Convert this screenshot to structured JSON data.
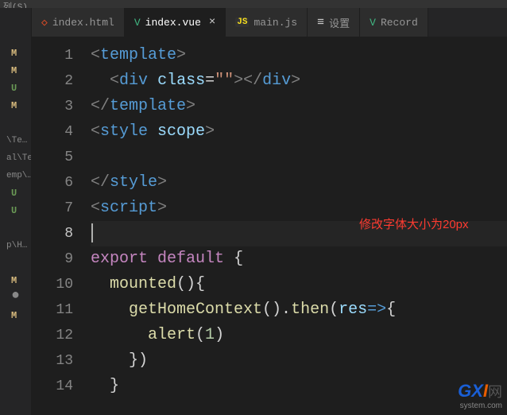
{
  "top_clipped": "列(S)   … ",
  "tabs": [
    {
      "label": "index.html",
      "icon": "html",
      "active": false,
      "close": false
    },
    {
      "label": "index.vue",
      "icon": "vue",
      "active": true,
      "close": true
    },
    {
      "label": "main.js",
      "icon": "js",
      "active": false,
      "close": false
    },
    {
      "label": "设置",
      "icon": "settings",
      "active": false,
      "close": false
    },
    {
      "label": "Record",
      "icon": "vue",
      "active": false,
      "close": false
    }
  ],
  "sidebar": {
    "items": [
      {
        "type": "mod",
        "text": "M"
      },
      {
        "type": "mod",
        "text": "M"
      },
      {
        "type": "u",
        "text": "U"
      },
      {
        "type": "mod",
        "text": "M"
      },
      {
        "type": "spacer",
        "text": ""
      },
      {
        "type": "path",
        "text": "\\Te…"
      },
      {
        "type": "path",
        "text": "al\\Te…"
      },
      {
        "type": "path",
        "text": "emp\\…"
      },
      {
        "type": "u",
        "text": "U"
      },
      {
        "type": "u",
        "text": "U"
      },
      {
        "type": "spacer",
        "text": ""
      },
      {
        "type": "path",
        "text": "p\\H…"
      },
      {
        "type": "spacer",
        "text": ""
      },
      {
        "type": "mod",
        "text": "M"
      },
      {
        "type": "dot",
        "text": "●"
      },
      {
        "type": "mod",
        "text": "M"
      }
    ]
  },
  "gutter": [
    "1",
    "2",
    "3",
    "4",
    "5",
    "6",
    "7",
    "8",
    "9",
    "10",
    "11",
    "12",
    "13",
    "14"
  ],
  "code": {
    "active_line": 8,
    "lines": [
      {
        "tokens": [
          [
            "p-bracket",
            "<"
          ],
          [
            "p-tag",
            "template"
          ],
          [
            "p-bracket",
            ">"
          ]
        ]
      },
      {
        "indent": 2,
        "tokens": [
          [
            "p-bracket",
            "<"
          ],
          [
            "p-tag",
            "div"
          ],
          [
            "",
            " "
          ],
          [
            "p-attr",
            "class"
          ],
          [
            "p-pn",
            "="
          ],
          [
            "p-str",
            "\"\""
          ],
          [
            "p-bracket",
            "></"
          ],
          [
            "p-tag",
            "div"
          ],
          [
            "p-bracket",
            ">"
          ]
        ]
      },
      {
        "tokens": [
          [
            "p-bracket",
            "</"
          ],
          [
            "p-tag",
            "template"
          ],
          [
            "p-bracket",
            ">"
          ]
        ]
      },
      {
        "tokens": [
          [
            "p-bracket",
            "<"
          ],
          [
            "p-tag",
            "style"
          ],
          [
            "",
            " "
          ],
          [
            "p-attr",
            "scope"
          ],
          [
            "p-bracket",
            ">"
          ]
        ]
      },
      {
        "tokens": []
      },
      {
        "tokens": [
          [
            "p-bracket",
            "</"
          ],
          [
            "p-tag",
            "style"
          ],
          [
            "p-bracket",
            ">"
          ]
        ]
      },
      {
        "tokens": [
          [
            "p-bracket",
            "<"
          ],
          [
            "p-tag",
            "script"
          ],
          [
            "p-bracket",
            ">"
          ]
        ]
      },
      {
        "tokens": [],
        "cursor": true
      },
      {
        "tokens": [
          [
            "p-kw",
            "export"
          ],
          [
            "",
            " "
          ],
          [
            "p-kw",
            "default"
          ],
          [
            "",
            " "
          ],
          [
            "p-pn",
            "{"
          ]
        ]
      },
      {
        "indent": 2,
        "tokens": [
          [
            "p-fn",
            "mounted"
          ],
          [
            "p-pn",
            "(){"
          ]
        ]
      },
      {
        "indent": 4,
        "tokens": [
          [
            "p-fn",
            "getHomeContext"
          ],
          [
            "p-pn",
            "()."
          ],
          [
            "p-fn",
            "then"
          ],
          [
            "p-pn",
            "("
          ],
          [
            "p-var",
            "res"
          ],
          [
            "p-op",
            "=>"
          ],
          [
            "p-pn",
            "{"
          ]
        ]
      },
      {
        "indent": 6,
        "tokens": [
          [
            "p-fn",
            "alert"
          ],
          [
            "p-pn",
            "("
          ],
          [
            "p-num",
            "1"
          ],
          [
            "p-pn",
            ")"
          ]
        ]
      },
      {
        "indent": 4,
        "tokens": [
          [
            "p-pn",
            "})"
          ]
        ]
      },
      {
        "indent": 2,
        "tokens": [
          [
            "p-pn",
            "}"
          ]
        ]
      }
    ]
  },
  "annotation": "修改字体大小为20px",
  "watermark": {
    "g": "G",
    "x": "X",
    "i": "I",
    "rest": "网"
  },
  "watermark_sub": "system.com"
}
